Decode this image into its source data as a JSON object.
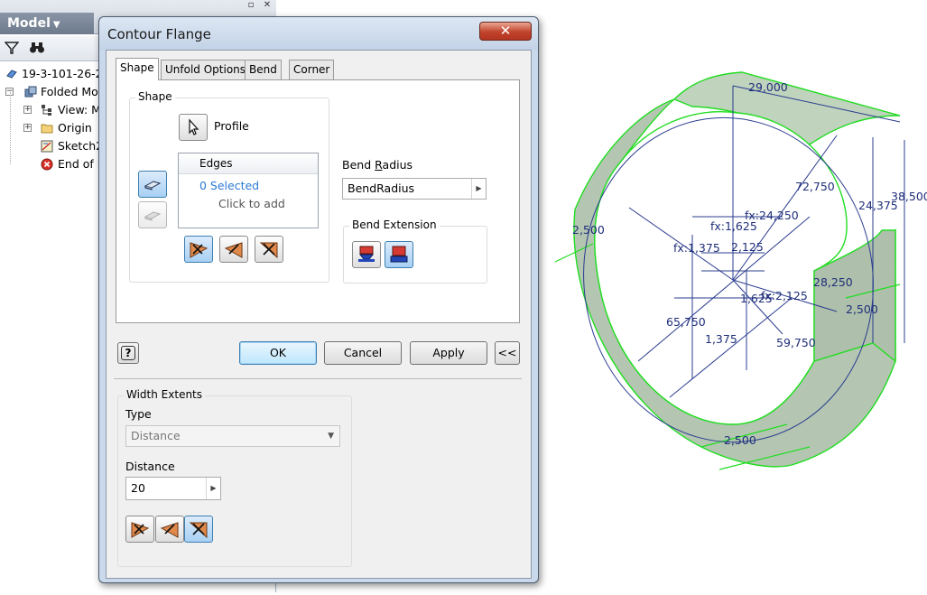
{
  "browser": {
    "title": "Model",
    "tree": [
      {
        "label": "19-3-101-26-2"
      },
      {
        "label": "Folded Mod"
      },
      {
        "label": "View: M"
      },
      {
        "label": "Origin"
      },
      {
        "label": "Sketch2"
      },
      {
        "label": "End of F"
      }
    ]
  },
  "dialog": {
    "title": "Contour Flange",
    "close_glyph": "✕",
    "tabs": [
      "Shape",
      "Unfold Options",
      "Bend",
      "Corner"
    ],
    "shape_group": {
      "legend": "Shape",
      "profile_label": "Profile",
      "edges_header": "Edges",
      "edges_selected": "0 Selected",
      "edges_hint": "Click to add"
    },
    "bend_radius": {
      "label_pre": "Bend ",
      "label_key": "R",
      "label_post": "adius",
      "value": "BendRadius"
    },
    "bend_extension": {
      "legend": "Bend Extension"
    },
    "buttons": {
      "help": "?",
      "ok": "OK",
      "cancel": "Cancel",
      "apply": "Apply",
      "more": "<<"
    },
    "width_extents": {
      "legend": "Width Extents",
      "type_label": "Type",
      "type_value": "Distance",
      "distance_label": "Distance",
      "distance_value": "20"
    }
  },
  "viewport": {
    "dimensions": [
      "29,000",
      "72,750",
      "24,375",
      "38,500",
      "fx:24,250",
      "fx:1,625",
      "2,125",
      "fx:1,375",
      "2,500",
      "28,250",
      "1,625",
      "fx:2,125",
      "2,500",
      "65,750",
      "1,375",
      "59,750",
      "2,500"
    ],
    "colors": {
      "edge": "#22dd22",
      "face": "#b7c9b5",
      "dim": "#1f2f7a"
    }
  }
}
